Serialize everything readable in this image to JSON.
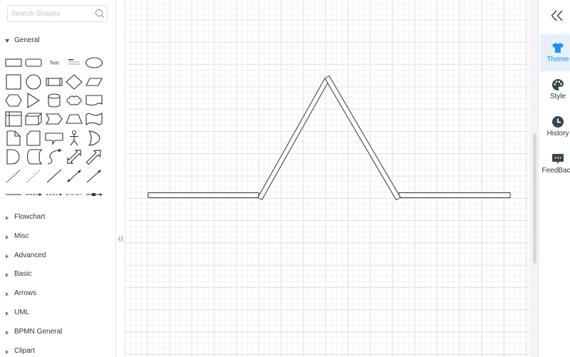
{
  "sidebar": {
    "search": {
      "placeholder": "Search Shapes",
      "icon": "search-icon"
    },
    "general": {
      "label": "General",
      "expanded": true,
      "shapes": [
        {
          "icon": "rectangle"
        },
        {
          "icon": "rounded-rectangle"
        },
        {
          "icon": "text",
          "label": "Text"
        },
        {
          "icon": "heading-textbox"
        },
        {
          "icon": "ellipse"
        },
        {
          "icon": "square"
        },
        {
          "icon": "circle"
        },
        {
          "icon": "process"
        },
        {
          "icon": "diamond"
        },
        {
          "icon": "parallelogram"
        },
        {
          "icon": "hexagon"
        },
        {
          "icon": "triangle"
        },
        {
          "icon": "cylinder"
        },
        {
          "icon": "cloud"
        },
        {
          "icon": "document"
        },
        {
          "icon": "internal-storage"
        },
        {
          "icon": "cube"
        },
        {
          "icon": "step"
        },
        {
          "icon": "trapezoid"
        },
        {
          "icon": "tape"
        },
        {
          "icon": "note"
        },
        {
          "icon": "card"
        },
        {
          "icon": "callout"
        },
        {
          "icon": "actor"
        },
        {
          "icon": "or"
        },
        {
          "icon": "delay"
        },
        {
          "icon": "stored-data"
        },
        {
          "icon": "curved-arrow"
        },
        {
          "icon": "bidirectional-arrow"
        },
        {
          "icon": "single-arrow"
        },
        {
          "icon": "dashed-line"
        },
        {
          "icon": "dotted-line"
        },
        {
          "icon": "line"
        },
        {
          "icon": "bidirectional-connector"
        },
        {
          "icon": "directional-connector"
        },
        {
          "icon": "thick-line"
        },
        {
          "icon": "link-arrow"
        },
        {
          "icon": "dashed-arrow"
        },
        {
          "icon": "dash-dot-link"
        },
        {
          "icon": "box-arrow"
        }
      ]
    },
    "categories": [
      {
        "label": "Flowchart"
      },
      {
        "label": "Misc"
      },
      {
        "label": "Advanced"
      },
      {
        "label": "Basic"
      },
      {
        "label": "Arrows"
      },
      {
        "label": "UML"
      },
      {
        "label": "BPMN General"
      },
      {
        "label": "Clipart"
      }
    ],
    "collapse_icon": "double-chevron-left-icon"
  },
  "right_panel": {
    "toggle_icon": "double-chevron-left-icon",
    "items": [
      {
        "label": "Theme",
        "icon": "tshirt-icon",
        "active": true
      },
      {
        "label": "Style",
        "icon": "palette-icon",
        "active": false
      },
      {
        "label": "History",
        "icon": "clock-icon",
        "active": false
      },
      {
        "label": "FeedBack",
        "icon": "feedback-icon",
        "active": false
      }
    ]
  },
  "colors": {
    "accent": "#1b8ef2",
    "active_item_bg": "#e6f1fc",
    "text": "#333333",
    "shape_stroke": "#333333",
    "panel_icon": "#37474f"
  }
}
